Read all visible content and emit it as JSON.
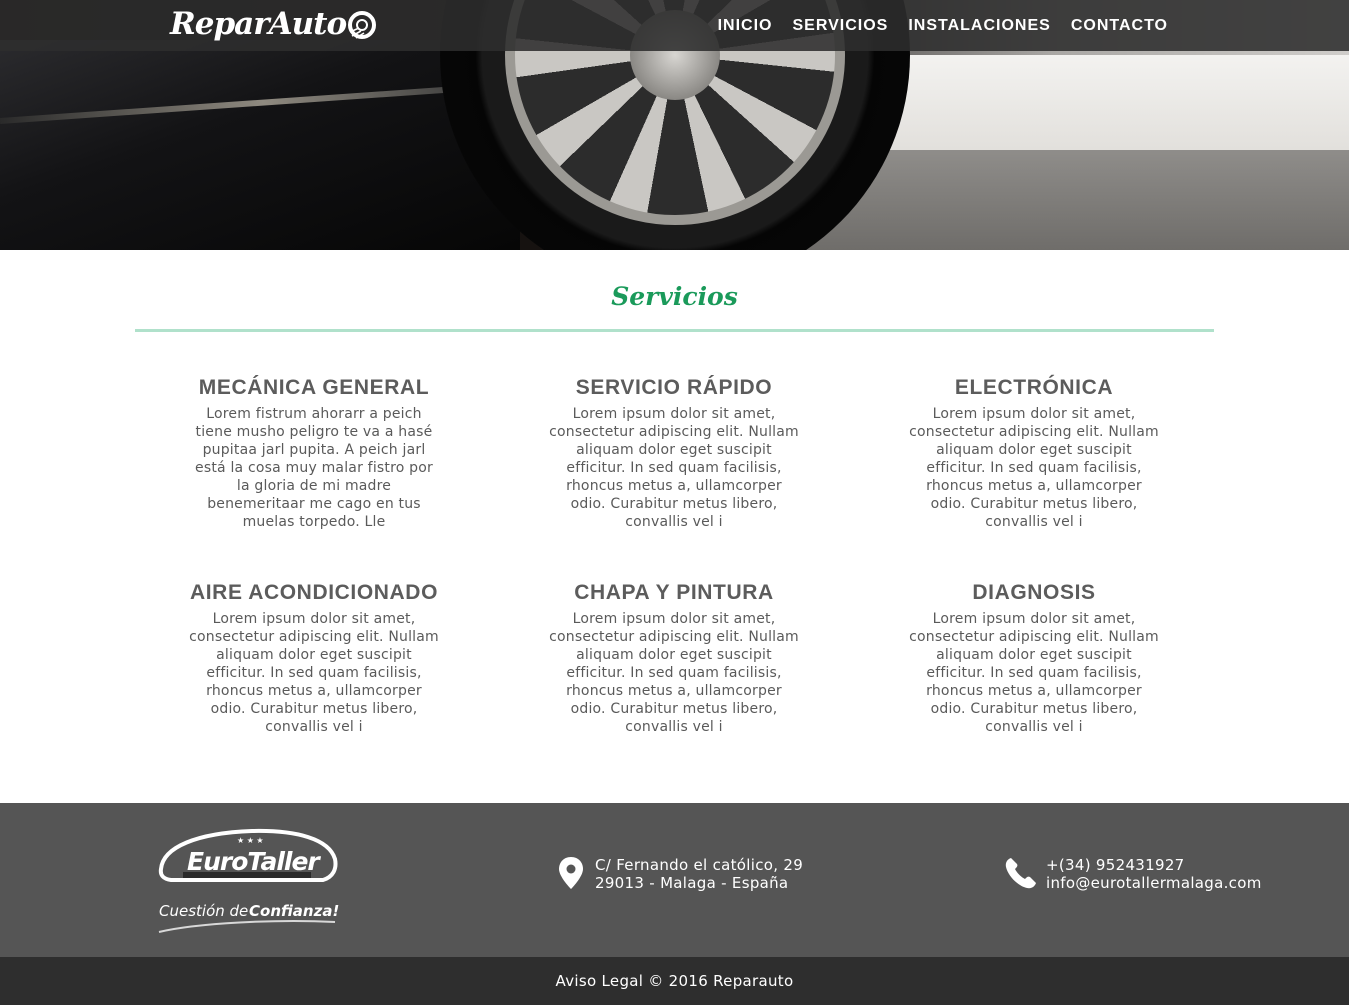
{
  "brand": {
    "name": "ReparAuto"
  },
  "nav": {
    "items": [
      {
        "label": "INICIO"
      },
      {
        "label": "SERVICIOS"
      },
      {
        "label": "INSTALACIONES"
      },
      {
        "label": "CONTACTO"
      }
    ]
  },
  "services": {
    "title": "Servicios",
    "items": [
      {
        "title": "MECÁNICA GENERAL",
        "text": "Lorem fistrum ahorarr a peich tiene musho peligro te va a hasé pupitaa jarl pupita. A peich jarl está la cosa muy malar fistro por la gloria de mi madre benemeritaar me cago en tus muelas torpedo. Lle"
      },
      {
        "title": "SERVICIO RÁPIDO",
        "text": "Lorem ipsum dolor sit amet, consectetur adipiscing elit. Nullam aliquam dolor eget suscipit efficitur. In sed quam facilisis, rhoncus metus a, ullamcorper odio. Curabitur metus libero, convallis vel i"
      },
      {
        "title": "ELECTRÓNICA",
        "text": "Lorem ipsum dolor sit amet, consectetur adipiscing elit. Nullam aliquam dolor eget suscipit efficitur. In sed quam facilisis, rhoncus metus a, ullamcorper odio. Curabitur metus libero, convallis vel i"
      },
      {
        "title": "AIRE ACONDICIONADO",
        "text": "Lorem ipsum dolor sit amet, consectetur adipiscing elit. Nullam aliquam dolor eget suscipit efficitur. In sed quam facilisis, rhoncus metus a, ullamcorper odio. Curabitur metus libero, convallis vel i"
      },
      {
        "title": "CHAPA Y PINTURA",
        "text": "Lorem ipsum dolor sit amet, consectetur adipiscing elit. Nullam aliquam dolor eget suscipit efficitur. In sed quam facilisis, rhoncus metus a, ullamcorper odio. Curabitur metus libero, convallis vel i"
      },
      {
        "title": "DIAGNOSIS",
        "text": "Lorem ipsum dolor sit amet, consectetur adipiscing elit. Nullam aliquam dolor eget suscipit efficitur. In sed quam facilisis, rhoncus metus a, ullamcorper odio. Curabitur metus libero, convallis vel i"
      }
    ]
  },
  "footer": {
    "partner_logo": {
      "name": "EuroTaller",
      "tagline_regular": "Cuestión de",
      "tagline_bold": "Confianza!"
    },
    "address": {
      "icon": "map-pin-icon",
      "line1": "C/ Fernando el católico, 29",
      "line2": "29013 - Malaga - España"
    },
    "contact": {
      "icon": "phone-icon",
      "phone": "+(34) 952431927",
      "email": "info@eurotallermalaga.com"
    },
    "copyright": "Aviso Legal © 2016 Reparauto"
  },
  "colors": {
    "accent_green": "#1a9a5a",
    "divider": "#b0e1cb",
    "footer_bg": "#555555",
    "bottom_bar_bg": "#2e2e2e",
    "navbar_bg": "#2d2d2d"
  }
}
